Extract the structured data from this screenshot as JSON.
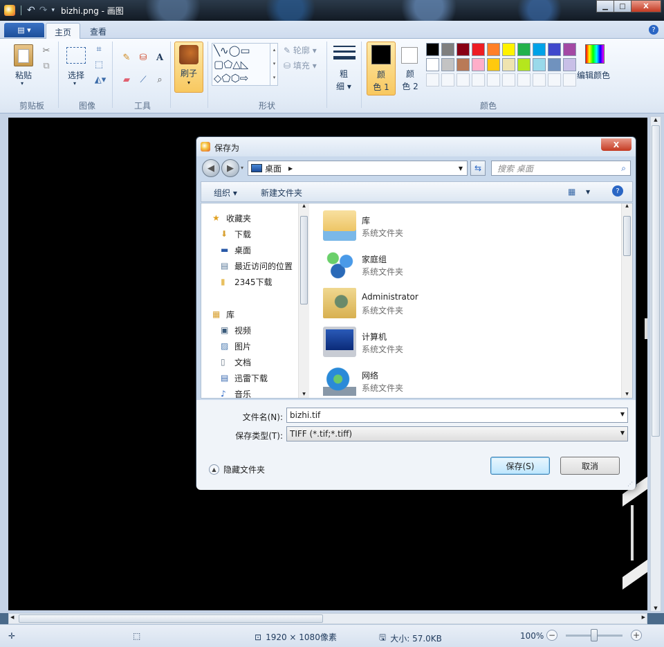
{
  "window": {
    "title": "bizhi.png - 画图",
    "min_label": "▁",
    "max_label": "□",
    "close_label": "X"
  },
  "ribbon": {
    "file_menu_label": "▤ ▾",
    "tabs": [
      {
        "label": "主页",
        "active": true
      },
      {
        "label": "查看",
        "active": false
      }
    ],
    "clipboard": {
      "paste_label": "粘贴",
      "group_label": "剪贴板"
    },
    "image": {
      "select_label": "选择",
      "group_label": "图像"
    },
    "tools": {
      "group_label": "工具"
    },
    "brushes": {
      "label": "刷子"
    },
    "shapes": {
      "outline_label": "轮廓",
      "fill_label": "填充",
      "group_label": "形状"
    },
    "size": {
      "label_top": "粗",
      "label_bottom": "细"
    },
    "color1": {
      "label_top": "颜",
      "label_bottom": "色 1",
      "value": "#000000"
    },
    "color2": {
      "label_top": "颜",
      "label_bottom": "色 2",
      "value": "#ffffff"
    },
    "colors_group_label": "颜色",
    "edit_colors_label": "编辑颜色",
    "palette_row1": [
      "#000000",
      "#7f7f7f",
      "#880015",
      "#ed1c24",
      "#ff7f27",
      "#fff200",
      "#22b14c",
      "#00a2e8",
      "#3f48cc",
      "#a349a4"
    ],
    "palette_row2": [
      "#ffffff",
      "#c3c3c3",
      "#b97a57",
      "#ffaec9",
      "#ffc90e",
      "#efe4b0",
      "#b5e61d",
      "#99d9ea",
      "#7092be",
      "#c8bfe7"
    ]
  },
  "dialog": {
    "title": "保存为",
    "close_label": "X",
    "address": "桌面",
    "search_placeholder": "搜索 桌面",
    "toolbar": {
      "organize_label": "组织 ▾",
      "new_folder_label": "新建文件夹"
    },
    "nav_items": [
      {
        "label": "收藏夹",
        "icon": "star-icon",
        "indent": 0
      },
      {
        "label": "下载",
        "icon": "downloads-folder-icon",
        "indent": 1
      },
      {
        "label": "桌面",
        "icon": "desktop-icon",
        "indent": 1
      },
      {
        "label": "最近访问的位置",
        "icon": "recent-places-icon",
        "indent": 1
      },
      {
        "label": "2345下载",
        "icon": "folder-icon",
        "indent": 1
      },
      {
        "label": "库",
        "icon": "library-icon",
        "indent": 0
      },
      {
        "label": "视频",
        "icon": "video-icon",
        "indent": 1
      },
      {
        "label": "图片",
        "icon": "pictures-icon",
        "indent": 1
      },
      {
        "label": "文档",
        "icon": "documents-icon",
        "indent": 1
      },
      {
        "label": "迅雷下载",
        "icon": "xunlei-download-icon",
        "indent": 1
      },
      {
        "label": "音乐",
        "icon": "music-icon",
        "indent": 1
      }
    ],
    "files": [
      {
        "name": "库",
        "type": "系统文件夹",
        "icon": "library-folder-icon"
      },
      {
        "name": "家庭组",
        "type": "系统文件夹",
        "icon": "homegroup-icon"
      },
      {
        "name": "Administrator",
        "type": "系统文件夹",
        "icon": "user-folder-icon"
      },
      {
        "name": "计算机",
        "type": "系统文件夹",
        "icon": "computer-icon"
      },
      {
        "name": "网络",
        "type": "系统文件夹",
        "icon": "network-icon"
      }
    ],
    "filename_label": "文件名(N):",
    "filename_value": "bizhi.tif",
    "filetype_label": "保存类型(T):",
    "filetype_value": "TIFF (*.tif;*.tiff)",
    "hide_folders_label": "隐藏文件夹",
    "save_label": "保存(S)",
    "cancel_label": "取消"
  },
  "status": {
    "dimensions": "1920 × 1080像素",
    "size": "大小: 57.0KB",
    "zoom": "100%"
  }
}
